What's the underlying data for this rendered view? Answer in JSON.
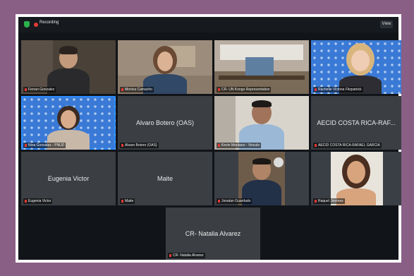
{
  "topbar": {
    "recording_label": "Recording",
    "view_label": "View"
  },
  "participants": [
    {
      "label": "Ferran Gonzalez"
    },
    {
      "label": "Monica Camacho"
    },
    {
      "label": "CR- UN Kongo Representative"
    },
    {
      "label": "Rachelle Victoria Fitzpatrick"
    },
    {
      "label": "Nina Gonzalez - PNUD"
    },
    {
      "label": "Alvaro Botero (OAS)",
      "display_name": "Alvaro Botero (OAS)"
    },
    {
      "label": "Kevin Montano - Vinculo"
    },
    {
      "label": "AECID COSTA RICA-RAFAEL GARCIA",
      "display_name": "AECID COSTA RICA-RAF..."
    },
    {
      "label": "Eugenia Victor",
      "display_name": "Eugenia Victor"
    },
    {
      "label": "Maite",
      "display_name": "Maite"
    },
    {
      "label": "Jonatan Guardado"
    },
    {
      "label": "Raquel Jiménez"
    },
    {
      "label": "CR- Natalia Alvarez",
      "display_name": "CR- Natalia Alvarez"
    }
  ]
}
